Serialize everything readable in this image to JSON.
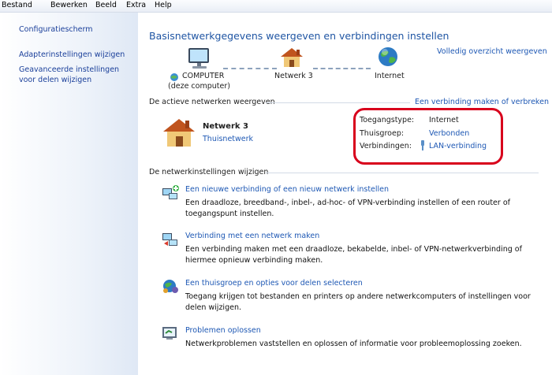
{
  "menu": [
    "Bestand",
    "Bewerken",
    "Beeld",
    "Extra",
    "Help"
  ],
  "sidebar": {
    "control_panel": "Configuratiescherm",
    "adapter": "Adapterinstellingen wijzigen",
    "advanced": "Geavanceerde instellingen voor delen wijzigen"
  },
  "main": {
    "title": "Basisnetwerkgegevens weergeven en verbindingen instellen",
    "full_overview": "Volledig overzicht weergeven",
    "map": {
      "computer_line1": "COMPUTER",
      "computer_line2": "(deze computer)",
      "network": "Netwerk  3",
      "internet": "Internet"
    },
    "active_heading": "De actieve netwerken weergeven",
    "connect_link": "Een verbinding maken of verbreken",
    "network_name": "Netwerk  3",
    "network_type": "Thuisnetwerk",
    "access_label": "Toegangstype:",
    "access_value": "Internet",
    "homegroup_label": "Thuisgroep:",
    "homegroup_value": "Verbonden",
    "connections_label": "Verbindingen:",
    "connections_value": "LAN-verbinding",
    "change_heading": "De netwerkinstellingen wijzigen",
    "tasks": [
      {
        "title": "Een nieuwe verbinding of een nieuw netwerk instellen",
        "desc": "Een draadloze, breedband-, inbel-, ad-hoc- of VPN-verbinding instellen of een router of toegangspunt instellen."
      },
      {
        "title": "Verbinding met een netwerk maken",
        "desc": "Een verbinding maken met een draadloze, bekabelde, inbel- of VPN-netwerkverbinding of hiermee opnieuw verbinding maken."
      },
      {
        "title": "Een thuisgroep en opties voor delen selecteren",
        "desc": "Toegang krijgen tot bestanden en printers op andere netwerkcomputers of instellingen voor delen wijzigen."
      },
      {
        "title": "Problemen oplossen",
        "desc": "Netwerkproblemen vaststellen en oplossen of informatie voor probleemoplossing zoeken."
      }
    ]
  }
}
